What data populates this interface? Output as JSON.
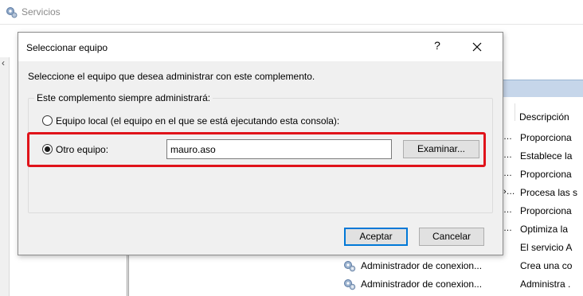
{
  "background_window": {
    "title": "Servicios",
    "column_header": "Descripción",
    "rows": [
      {
        "dots": "…",
        "description": "Proporciona"
      },
      {
        "dots": "…",
        "description": "Establece la"
      },
      {
        "dots": "…",
        "description": "Proporciona"
      },
      {
        "dots": "›…",
        "description": "Procesa las s"
      },
      {
        "dots": "…",
        "description": "Proporciona"
      },
      {
        "dots": "…",
        "description": "Optimiza la"
      },
      {
        "dots": "",
        "description": "El servicio A"
      },
      {
        "name": "Administrador de conexion...",
        "description": "Crea una co"
      },
      {
        "name": "Administrador de conexion...",
        "description": "Administra ."
      }
    ]
  },
  "dialog": {
    "title": "Seleccionar equipo",
    "help_symbol": "?",
    "instruction": "Seleccione el equipo que desea administrar con este complemento.",
    "group_label": "Este complemento siempre administrará:",
    "option_local": "Equipo local (el equipo en el que se está ejecutando esta consola):",
    "option_other": "Otro equipo:",
    "option_other_selected": true,
    "computer_name": "mauro.aso",
    "browse_button": "Examinar...",
    "accept_button": "Aceptar",
    "cancel_button": "Cancelar",
    "highlight_color": "#e0131a"
  },
  "icons": {
    "title_icon": "gear-icon",
    "service_icon": "service-gear-icon",
    "close_icon": "close-icon"
  }
}
